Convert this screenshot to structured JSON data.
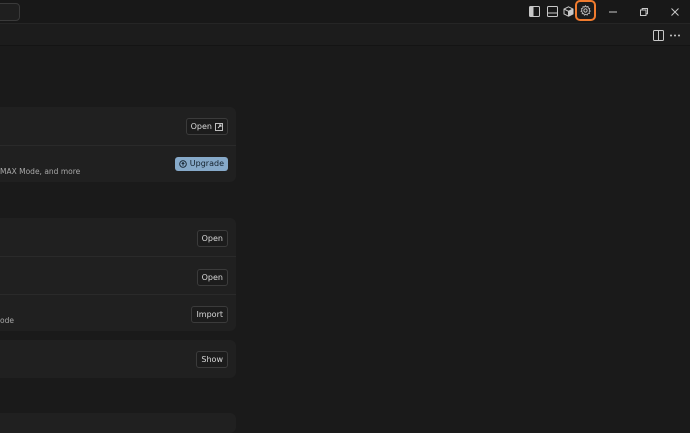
{
  "header": {
    "icons": [
      "toggle-primary-sidebar-icon",
      "toggle-panel-icon",
      "cube-icon",
      "settings-gear-icon"
    ],
    "window_controls": [
      "minimize-icon",
      "restore-icon",
      "close-icon"
    ]
  },
  "tabbar": {
    "icons": [
      "split-editor-icon",
      "more-actions-icon"
    ]
  },
  "cards": [
    {
      "rows": [
        {
          "description": "",
          "button": "Open",
          "button_icon": "external-link-icon"
        },
        {
          "description": "MAX Mode, and more",
          "button": "Upgrade",
          "button_icon": "upgrade-icon"
        }
      ]
    },
    {
      "rows": [
        {
          "description": "",
          "button": "Open"
        },
        {
          "description": "",
          "button": "Open"
        },
        {
          "description": "ode",
          "button": "Import"
        }
      ]
    },
    {
      "rows": [
        {
          "description": "",
          "button": "Show"
        }
      ]
    }
  ],
  "colors": {
    "accent_highlight": "#f07b2e",
    "upgrade_button": "#86a9c9"
  }
}
